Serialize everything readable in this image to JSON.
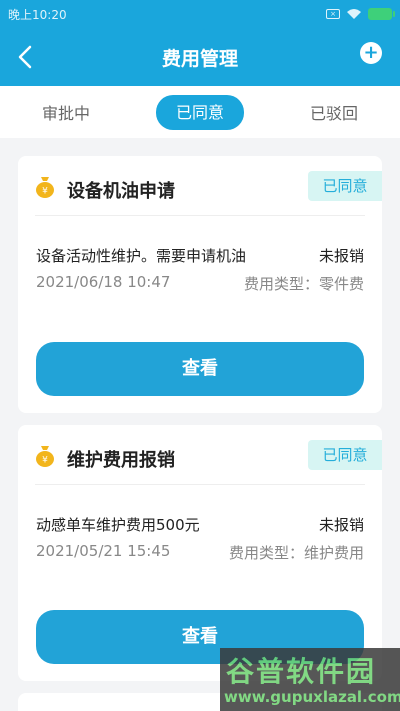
{
  "status_bar": {
    "time": "晚上10:20",
    "sim_label": "×"
  },
  "nav": {
    "title": "费用管理",
    "add_symbol": "+"
  },
  "tabs": [
    {
      "label": "审批中",
      "active": false
    },
    {
      "label": "已同意",
      "active": true
    },
    {
      "label": "已驳回",
      "active": false
    }
  ],
  "cards": [
    {
      "title": "设备机油申请",
      "status": "已同意",
      "description": "设备活动性维护。需要申请机油",
      "reimbursement": "未报销",
      "date": "2021/06/18 10:47",
      "expense_type": "费用类型：零件费",
      "button": "查看"
    },
    {
      "title": "维护费用报销",
      "status": "已同意",
      "description": "动感单车维护费用500元",
      "reimbursement": "未报销",
      "date": "2021/05/21 15:45",
      "expense_type": "费用类型：维护费用",
      "button": "查看"
    }
  ],
  "watermark": {
    "big": "谷普软件园",
    "small": "www.gupuxlazal.com"
  },
  "colors": {
    "primary": "#1aa6dc",
    "badge_bg": "#d7f5f3",
    "icon": "#f2b51c"
  }
}
